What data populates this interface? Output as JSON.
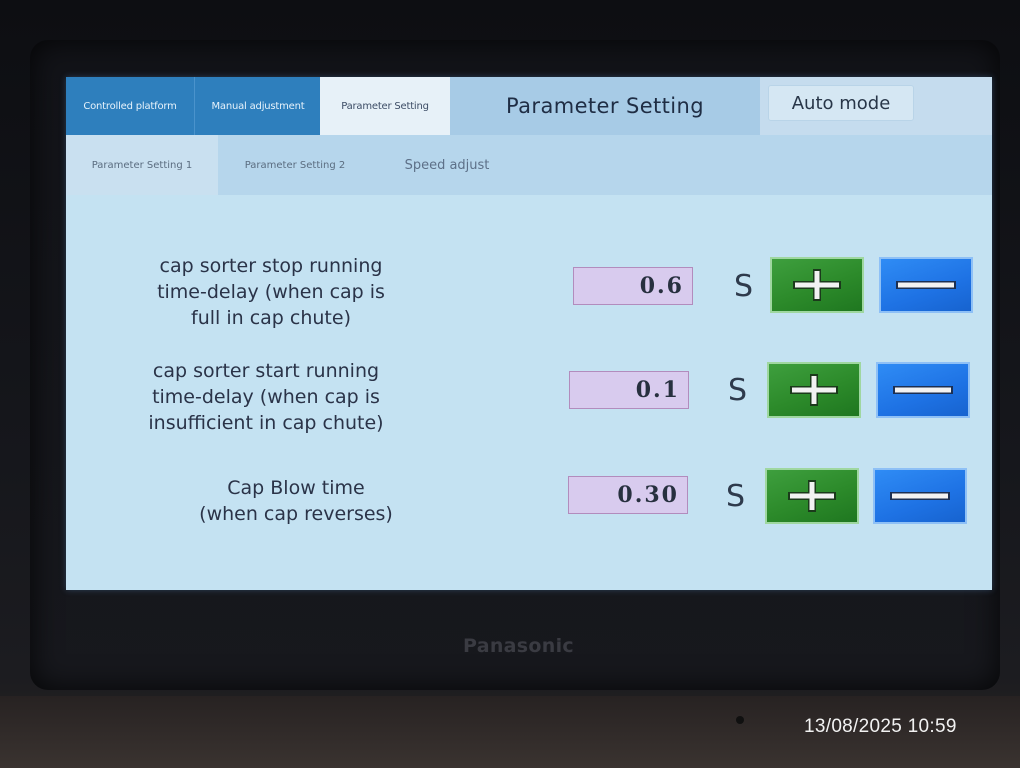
{
  "tabs_main": [
    "Controlled platform",
    "Manual adjustment",
    "Parameter Setting"
  ],
  "header": {
    "title": "Parameter Setting",
    "mode": "Auto mode"
  },
  "tabs_sub": [
    "Parameter Setting 1",
    "Parameter Setting 2",
    "Speed adjust"
  ],
  "params": [
    {
      "label": "cap sorter stop running\ntime-delay (when cap is\nfull in cap chute)",
      "value": "0.6",
      "unit": "S"
    },
    {
      "label": "cap sorter start running\ntime-delay (when cap is\ninsufficient in cap chute)",
      "value": "0.1",
      "unit": "S"
    },
    {
      "label": "Cap Blow time\n(when cap reverses)",
      "value": "0.30",
      "unit": "S"
    }
  ],
  "brand": "Panasonic",
  "timestamp": "13/08/2025 10:59",
  "colors": {
    "active_tab": "#2e7fbd",
    "plus_button": "#2c8a2a",
    "minus_button": "#1e72e4",
    "value_box": "#d8cbee"
  },
  "icons": {
    "plus": "plus-icon",
    "minus": "minus-icon"
  }
}
